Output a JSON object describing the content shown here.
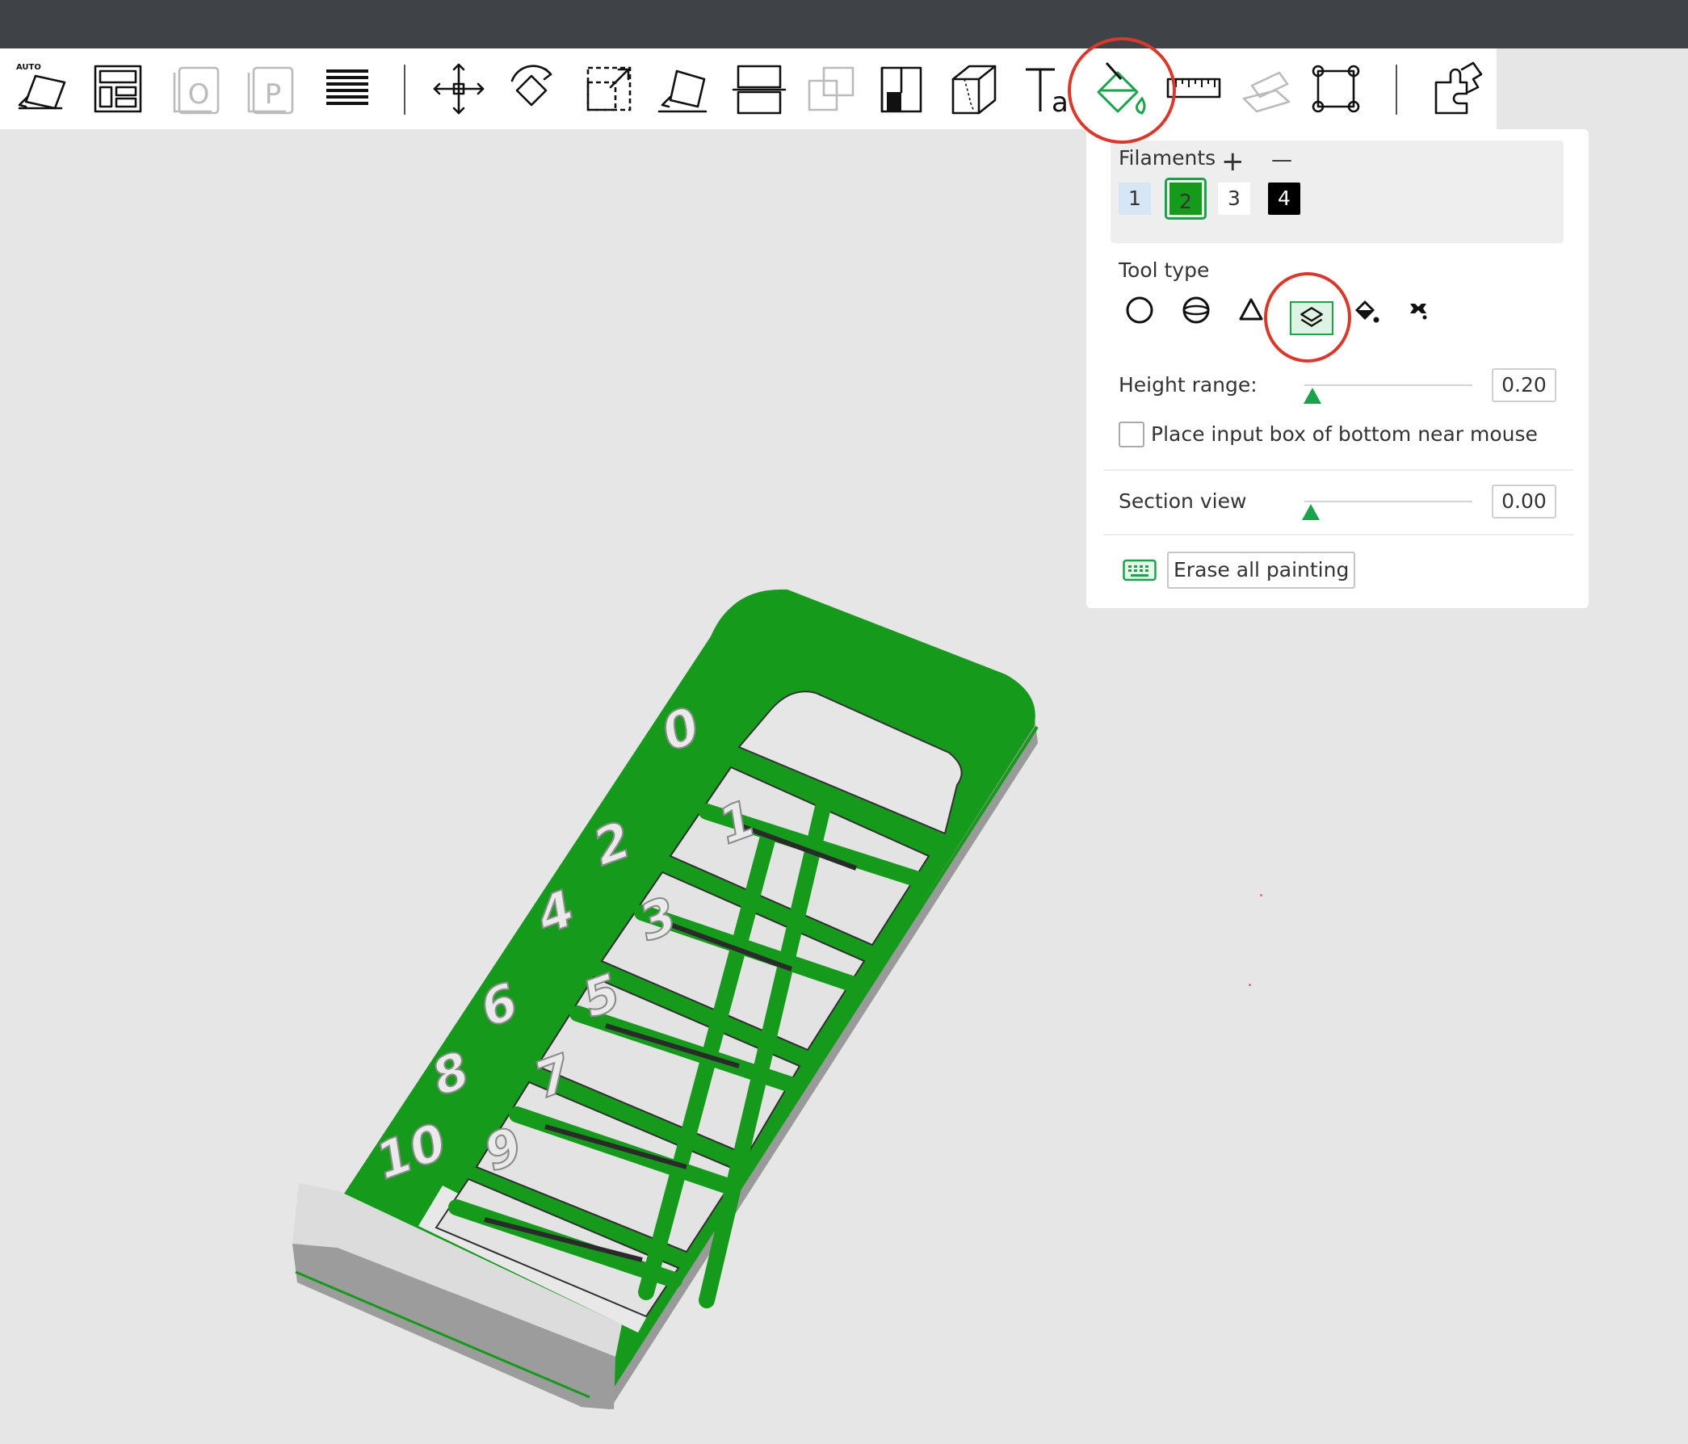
{
  "toolbar": {
    "buttons": [
      {
        "name": "auto-orient-button",
        "icon": "auto-orient-icon",
        "badge": "AUTO"
      },
      {
        "name": "arrange-button",
        "icon": "arrange-icon"
      },
      {
        "name": "add-plate-button",
        "icon": "plate-o-icon",
        "glyph": "O"
      },
      {
        "name": "plate-p-button",
        "icon": "plate-p-icon",
        "glyph": "P"
      },
      {
        "name": "layers-menu-button",
        "icon": "hamburger-icon"
      },
      {
        "name": "move-button",
        "icon": "move-icon"
      },
      {
        "name": "rotate-button",
        "icon": "rotate-icon"
      },
      {
        "name": "scale-button",
        "icon": "scale-icon"
      },
      {
        "name": "lay-on-face-button",
        "icon": "lay-on-face-icon"
      },
      {
        "name": "split-button",
        "icon": "split-icon"
      },
      {
        "name": "boolean-button",
        "icon": "boolean-icon"
      },
      {
        "name": "support-paint-button",
        "icon": "support-paint-icon"
      },
      {
        "name": "seam-paint-button",
        "icon": "seam-icon"
      },
      {
        "name": "text-button",
        "icon": "text-icon",
        "glyph": "Ta"
      },
      {
        "name": "color-paint-button",
        "icon": "paint-bucket-icon"
      },
      {
        "name": "measure-button",
        "icon": "ruler-icon"
      },
      {
        "name": "assembly-button",
        "icon": "assembly-icon"
      },
      {
        "name": "variable-layer-button",
        "icon": "bounding-box-icon"
      },
      {
        "name": "brim-ears-button",
        "icon": "puzzle-icon"
      }
    ]
  },
  "panel": {
    "filaments_label": "Filaments",
    "add_symbol": "+",
    "remove_symbol": "—",
    "filaments": [
      {
        "label": "1",
        "color": "#d6e6f4"
      },
      {
        "label": "2",
        "color": "#169a1c",
        "selected": true
      },
      {
        "label": "3",
        "color": "#ffffff"
      },
      {
        "label": "4",
        "color": "#000000"
      }
    ],
    "tool_type_label": "Tool type",
    "tool_types": [
      {
        "name": "circle-tool",
        "icon": "circle-icon"
      },
      {
        "name": "sphere-tool",
        "icon": "sphere-icon"
      },
      {
        "name": "triangle-tool",
        "icon": "triangle-icon"
      },
      {
        "name": "height-range-tool",
        "icon": "layers-icon",
        "selected": true
      },
      {
        "name": "fill-tool",
        "icon": "fill-bucket-icon"
      },
      {
        "name": "gap-fill-tool",
        "icon": "gap-fill-icon"
      }
    ],
    "height_range_label": "Height range:",
    "height_range_value": "0.20",
    "height_range_level": 0.05,
    "place_input_label": "Place input box of bottom near mouse",
    "place_input_checked": false,
    "section_view_label": "Section view",
    "section_view_value": "0.00",
    "section_view_level": 0.04,
    "keyboard_icon": "keyboard-icon",
    "erase_label": "Erase all painting"
  },
  "model": {
    "numbers_left": [
      "0",
      "2",
      "4",
      "6",
      "8",
      "10"
    ],
    "numbers_right": [
      "1",
      "3",
      "5",
      "7",
      "9"
    ],
    "paint_color": "#169a1c",
    "base_color": "#c8c8c8"
  },
  "colors": {
    "accent": "#1ba34b",
    "annotation": "#d9392b",
    "titlebar": "#3f4347",
    "viewport": "#e6e6e6"
  }
}
